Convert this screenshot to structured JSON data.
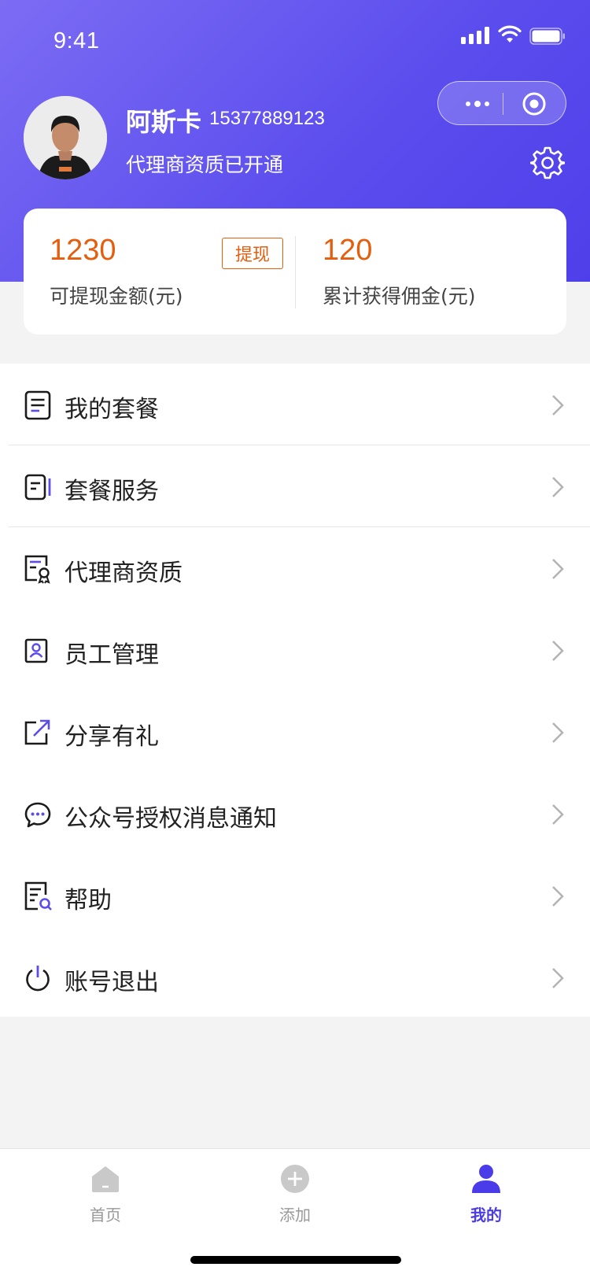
{
  "status_bar": {
    "time": "9:41"
  },
  "profile": {
    "name": "阿斯卡",
    "phone": "15377889123",
    "status": "代理商资质已开通"
  },
  "balance_card": {
    "withdrawable_value": "1230",
    "withdrawable_label": "可提现金额(元)",
    "withdraw_button": "提现",
    "commission_value": "120",
    "commission_label": "累计获得佣金(元)"
  },
  "menu": {
    "items": [
      {
        "label": "我的套餐",
        "icon": "document-icon"
      },
      {
        "label": "套餐服务",
        "icon": "service-icon"
      },
      {
        "label": "代理商资质",
        "icon": "certificate-icon"
      },
      {
        "label": "员工管理",
        "icon": "employee-icon"
      },
      {
        "label": "分享有礼",
        "icon": "share-icon"
      },
      {
        "label": "公众号授权消息通知",
        "icon": "chat-icon"
      },
      {
        "label": "帮助",
        "icon": "help-icon"
      },
      {
        "label": "账号退出",
        "icon": "power-icon"
      }
    ]
  },
  "tabbar": {
    "tabs": [
      {
        "label": "首页",
        "icon": "home-icon",
        "active": false
      },
      {
        "label": "添加",
        "icon": "plus-circle-icon",
        "active": false
      },
      {
        "label": "我的",
        "icon": "user-icon",
        "active": true
      }
    ]
  },
  "colors": {
    "brand": "#5a4ced",
    "accent_orange": "#e35f0f",
    "active_tab": "#4a3ce8"
  }
}
